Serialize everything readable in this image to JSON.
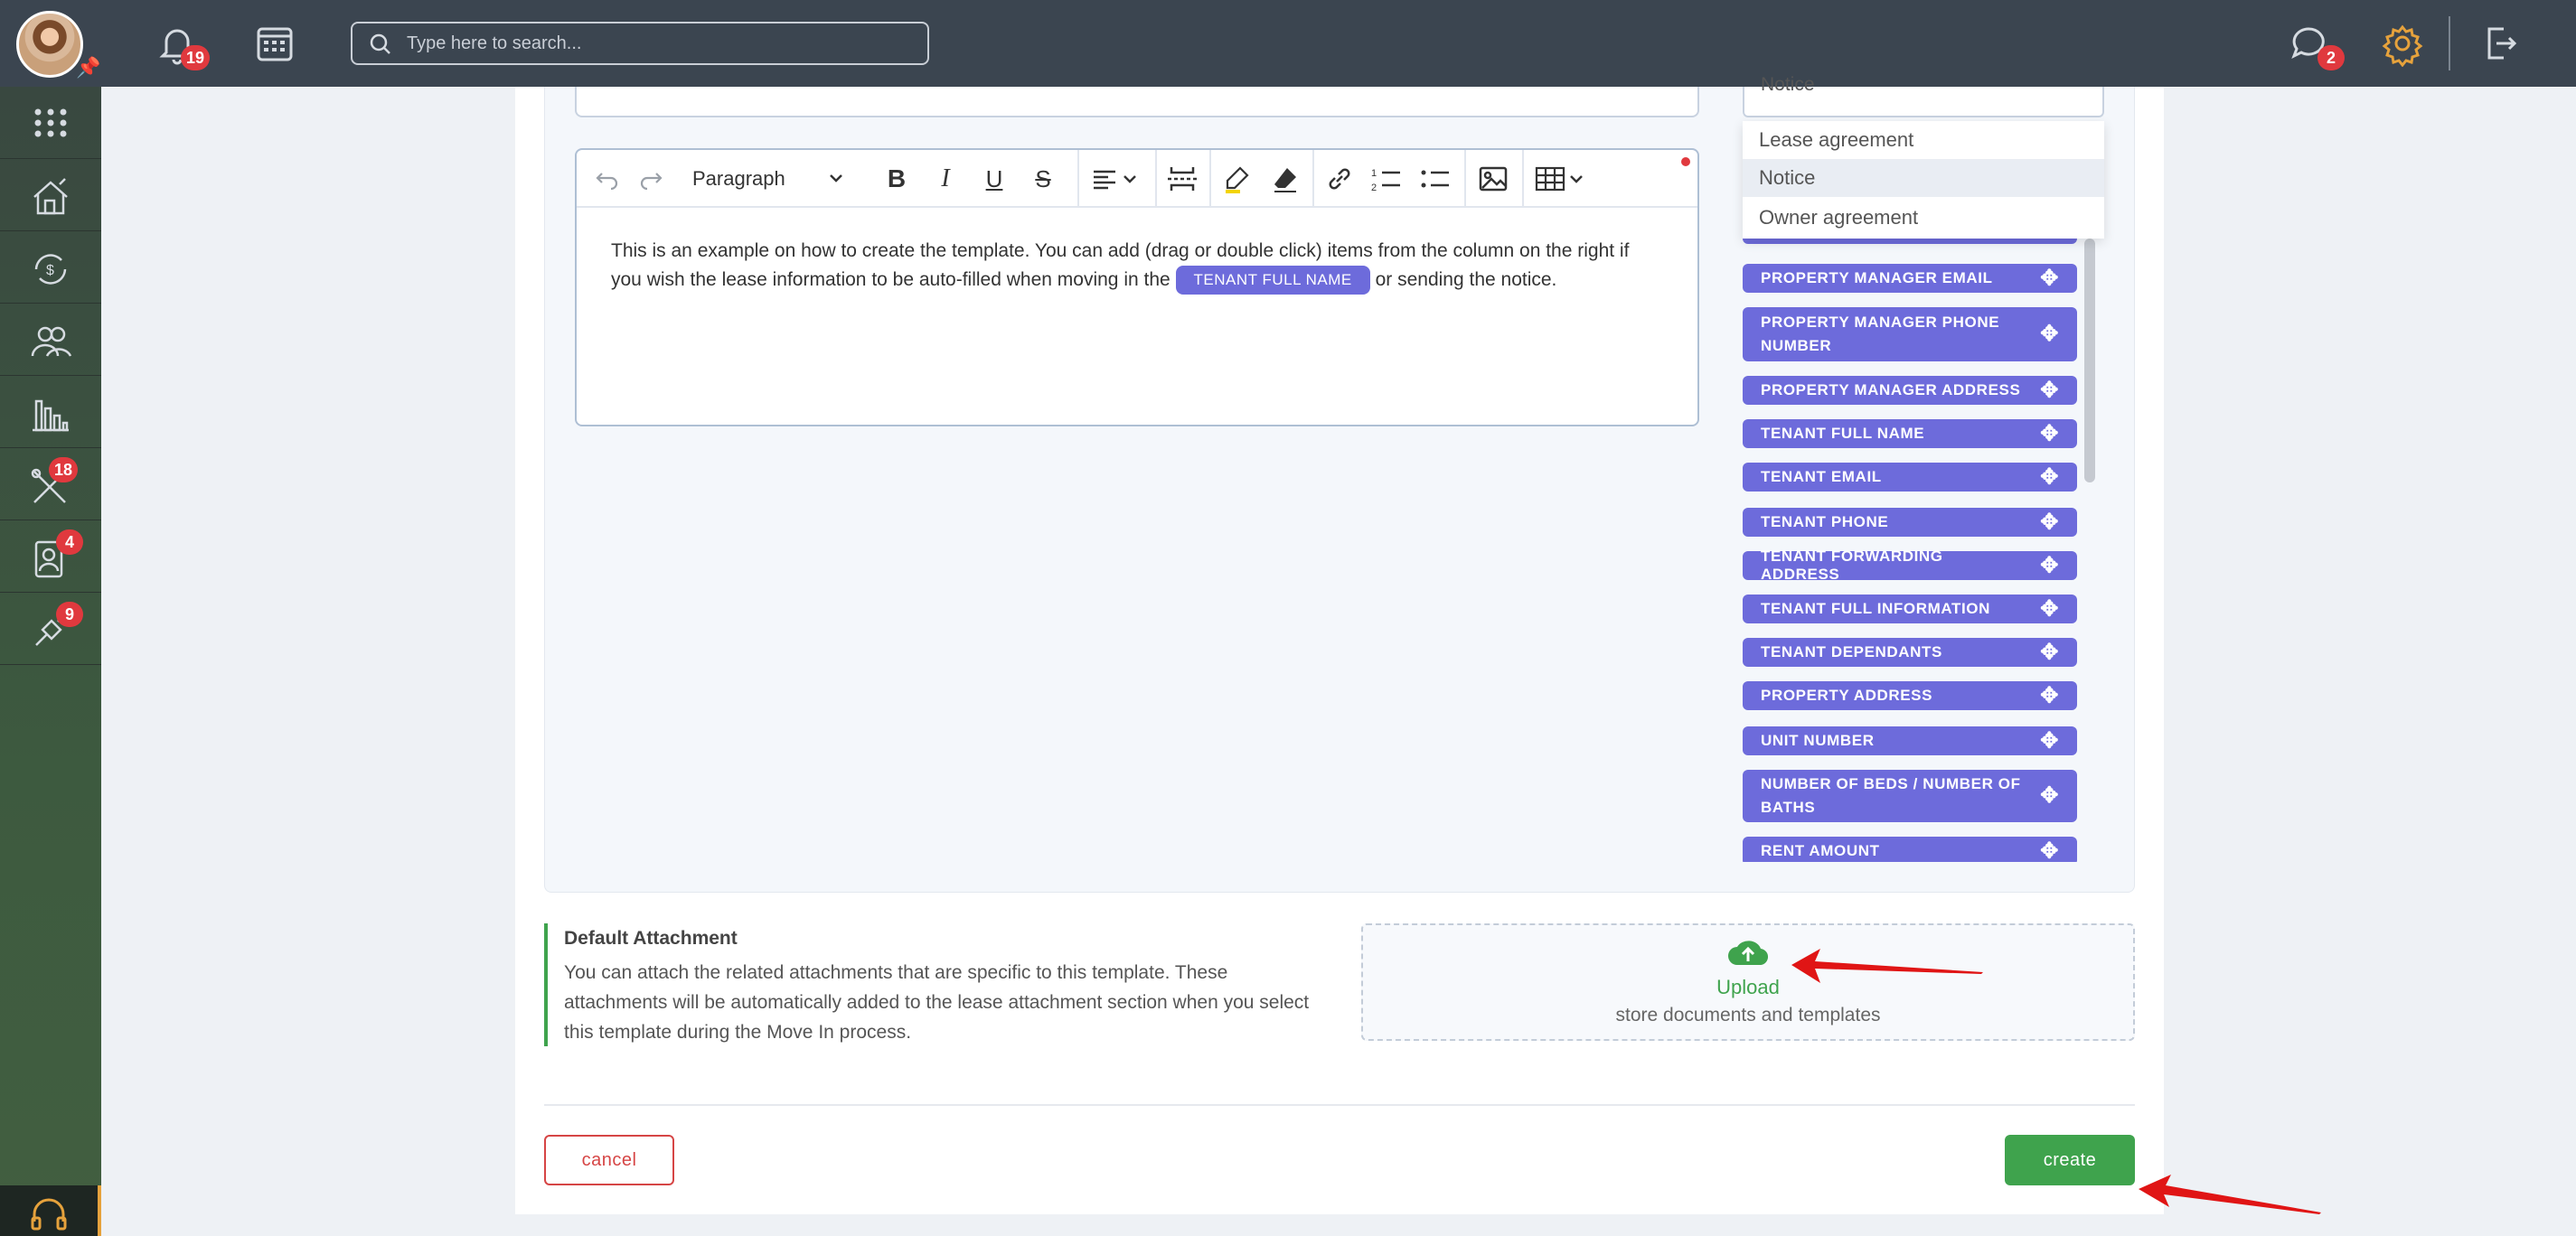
{
  "topbar": {
    "notifications_badge": "19",
    "messages_badge": "2",
    "search_placeholder": "Type here to search..."
  },
  "sidebar": {
    "items": [
      {
        "icon": "apps-grid-icon",
        "badge": ""
      },
      {
        "icon": "property-house-icon",
        "badge": ""
      },
      {
        "icon": "finance-cycle-icon",
        "badge": ""
      },
      {
        "icon": "people-icon",
        "badge": ""
      },
      {
        "icon": "reports-chart-icon",
        "badge": ""
      },
      {
        "icon": "maintenance-tools-icon",
        "badge": "18"
      },
      {
        "icon": "contacts-icon",
        "badge": "4"
      },
      {
        "icon": "integrations-icon",
        "badge": "9"
      }
    ]
  },
  "template_type": {
    "selected": "Notice",
    "options": [
      "Lease agreement",
      "Notice",
      "Owner agreement"
    ]
  },
  "editor": {
    "paragraph_style": "Paragraph",
    "body_before": "This is an example on how to create the template. You can add (drag or double click) items from the column on the right if you wish the lease information to be auto-filled when moving in the",
    "inline_chip": "TENANT FULL NAME",
    "body_after": "or sending the notice."
  },
  "merge_fields": [
    "PROPERTY MANAGER EMAIL",
    "PROPERTY MANAGER PHONE NUMBER",
    "PROPERTY MANAGER ADDRESS",
    "TENANT FULL NAME",
    "TENANT EMAIL",
    "TENANT PHONE",
    "TENANT FORWARDING ADDRESS",
    "TENANT FULL INFORMATION",
    "TENANT DEPENDANTS",
    "PROPERTY ADDRESS",
    "UNIT NUMBER",
    "NUMBER OF BEDS / NUMBER OF BATHS",
    "RENT AMOUNT"
  ],
  "attachment": {
    "title": "Default Attachment",
    "description": "You can attach the related attachments that are specific to this template. These attachments will be automatically added to the lease attachment section when you select this template during the Move In process.",
    "upload_label": "Upload",
    "upload_sub": "store documents and templates"
  },
  "actions": {
    "cancel": "cancel",
    "create": "create"
  },
  "colors": {
    "topbar": "#3b4550",
    "chip": "#6d6bdb",
    "primary_green": "#3fa34d",
    "danger": "#d64545",
    "badge": "#e0393e",
    "annotation_arrow": "#e01515"
  }
}
